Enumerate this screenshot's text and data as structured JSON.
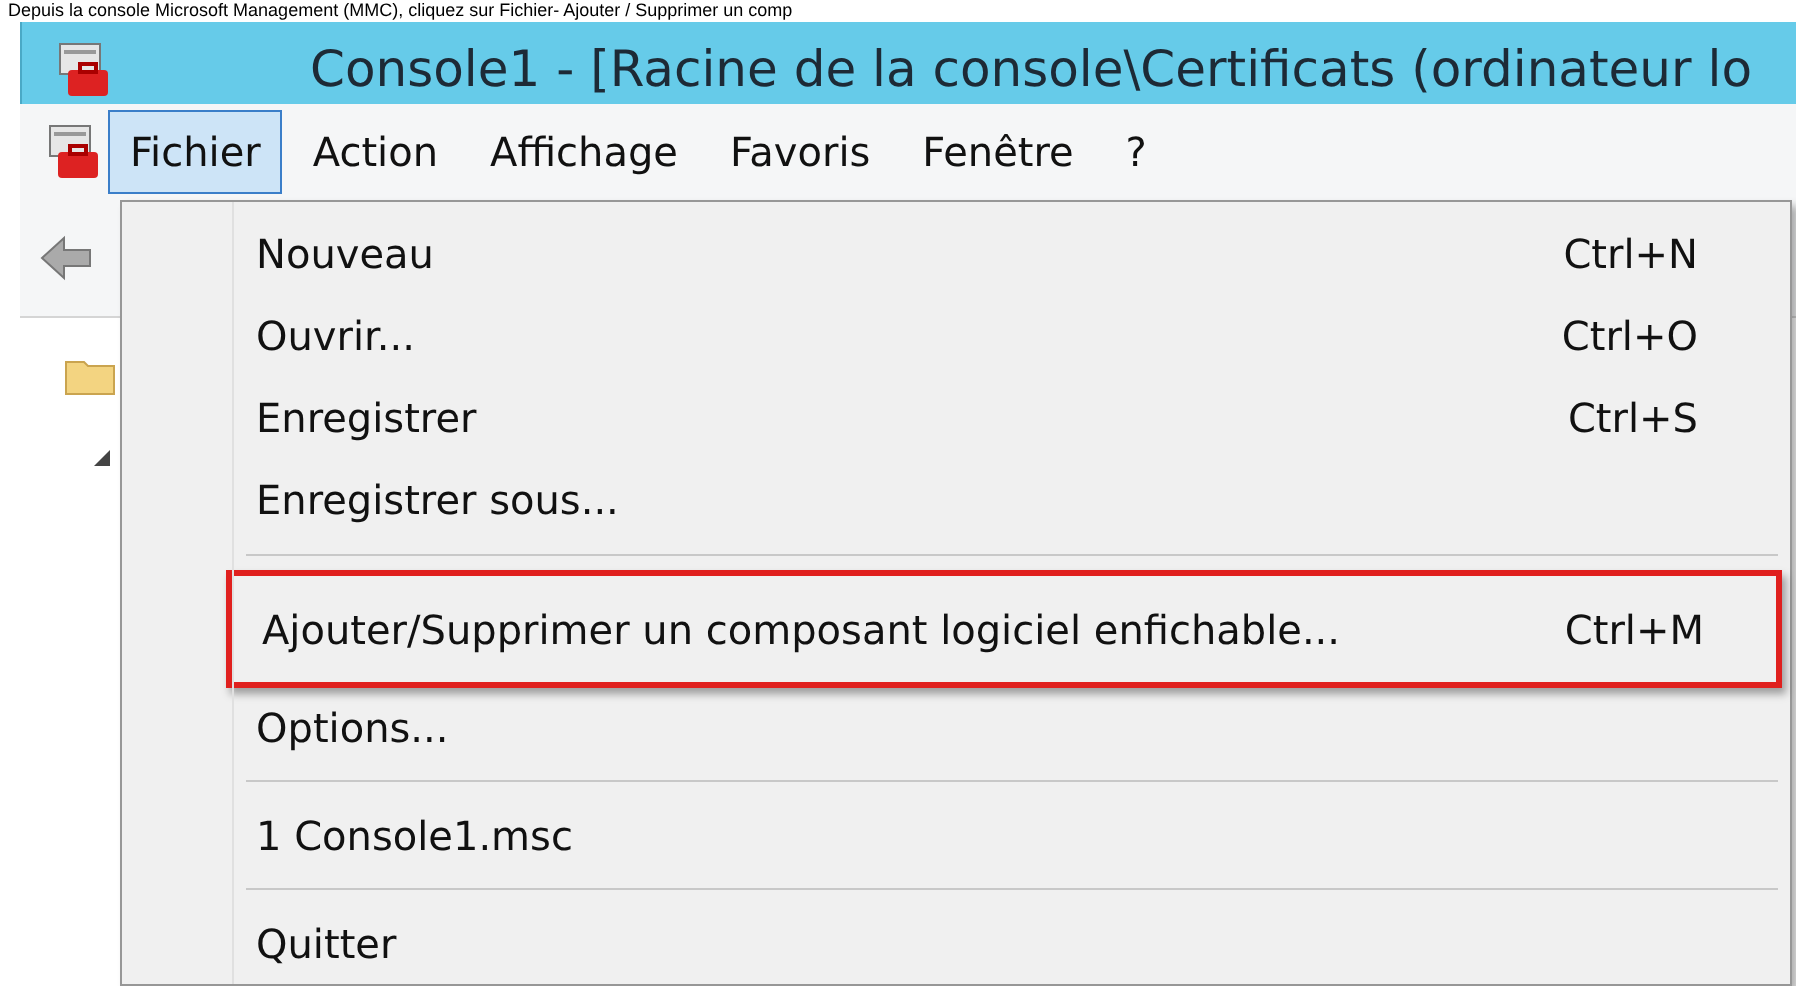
{
  "caption": "Depuis la console Microsoft Management (MMC), cliquez sur Fichier- Ajouter / Supprimer un comp",
  "window": {
    "title": "Console1 - [Racine de la console\\Certificats (ordinateur lo"
  },
  "menubar": [
    {
      "label": "Fichier",
      "selected": true
    },
    {
      "label": "Action",
      "selected": false
    },
    {
      "label": "Affichage",
      "selected": false
    },
    {
      "label": "Favoris",
      "selected": false
    },
    {
      "label": "Fenêtre",
      "selected": false
    },
    {
      "label": "?",
      "selected": false
    }
  ],
  "menu": [
    {
      "kind": "item",
      "label": "Nouveau",
      "shortcut": "Ctrl+N",
      "highlighted": false
    },
    {
      "kind": "item",
      "label": "Ouvrir...",
      "shortcut": "Ctrl+O",
      "highlighted": false
    },
    {
      "kind": "item",
      "label": "Enregistrer",
      "shortcut": "Ctrl+S",
      "highlighted": false
    },
    {
      "kind": "item",
      "label": "Enregistrer sous...",
      "highlighted": false
    },
    {
      "kind": "separator"
    },
    {
      "kind": "item",
      "label": "Ajouter/Supprimer un composant logiciel enfichable...",
      "shortcut": "Ctrl+M",
      "highlighted": true
    },
    {
      "kind": "item",
      "label": "Options...",
      "highlighted": false
    },
    {
      "kind": "separator"
    },
    {
      "kind": "item",
      "label": "1 Console1.msc",
      "highlighted": false
    },
    {
      "kind": "separator"
    },
    {
      "kind": "item",
      "label": "Quitter",
      "highlighted": false
    }
  ]
}
